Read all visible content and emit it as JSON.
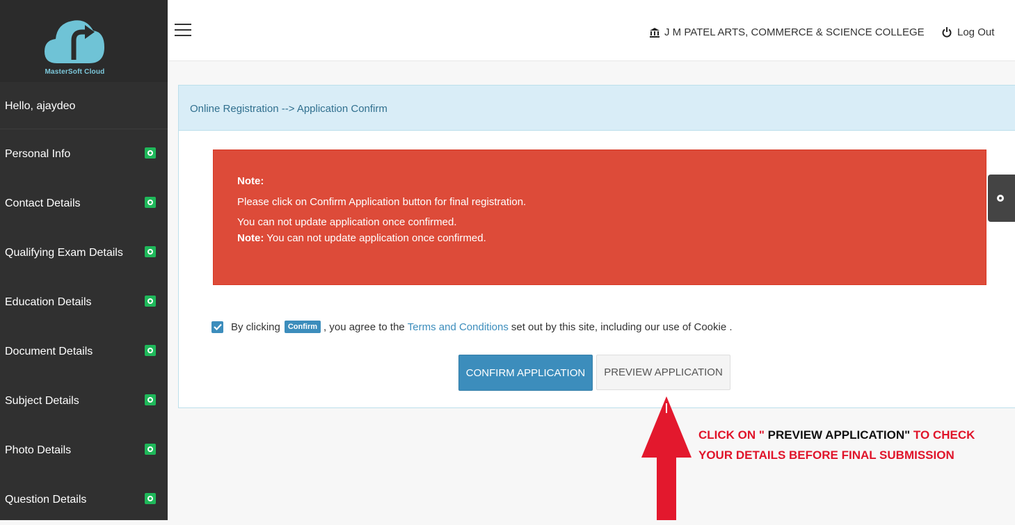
{
  "brand": {
    "logo_text": "MasterSoft Cloud"
  },
  "sidebar": {
    "greeting": "Hello, ajaydeo",
    "items": [
      {
        "label": "Personal Info"
      },
      {
        "label": "Contact Details"
      },
      {
        "label": "Qualifying Exam Details"
      },
      {
        "label": "Education Details"
      },
      {
        "label": "Document Details"
      },
      {
        "label": "Subject Details"
      },
      {
        "label": "Photo Details"
      },
      {
        "label": "Question Details"
      }
    ]
  },
  "topbar": {
    "college": "J M PATEL ARTS, COMMERCE & SCIENCE COLLEGE",
    "logout": "Log Out"
  },
  "panel": {
    "breadcrumb": "Online Registration --> Application Confirm"
  },
  "alert": {
    "title": "Note:",
    "line1": "Please click on Confirm Application button for final registration.",
    "line2": "You can not update application once confirmed.",
    "line3_bold": "Note:",
    "line3_text": " You can not update application once confirmed."
  },
  "terms": {
    "prefix": "By clicking",
    "tag": "Confirm",
    "middle": ", you agree to the",
    "link": "Terms and Conditions",
    "suffix": "set out by this site, including our use of Cookie ."
  },
  "buttons": {
    "confirm": "CONFIRM APPLICATION",
    "preview": "PREVIEW APPLICATION"
  },
  "callout": {
    "part1": "CLICK ON \"",
    "part2": " PREVIEW APPLICATION\"",
    "part3": " TO CHECK YOUR DETAILS BEFORE FINAL SUBMISSION"
  },
  "colors": {
    "sidebar_bg": "#303030",
    "accent": "#3c8dbc",
    "alert_red": "#dd4b39",
    "badge_green": "#1fb85a",
    "callout_red": "#e0142a"
  },
  "icons": [
    "cloud-logo-icon",
    "hamburger-icon",
    "bank-icon",
    "power-icon",
    "status-icon",
    "check-icon",
    "gear-icon",
    "arrow-up-icon"
  ]
}
